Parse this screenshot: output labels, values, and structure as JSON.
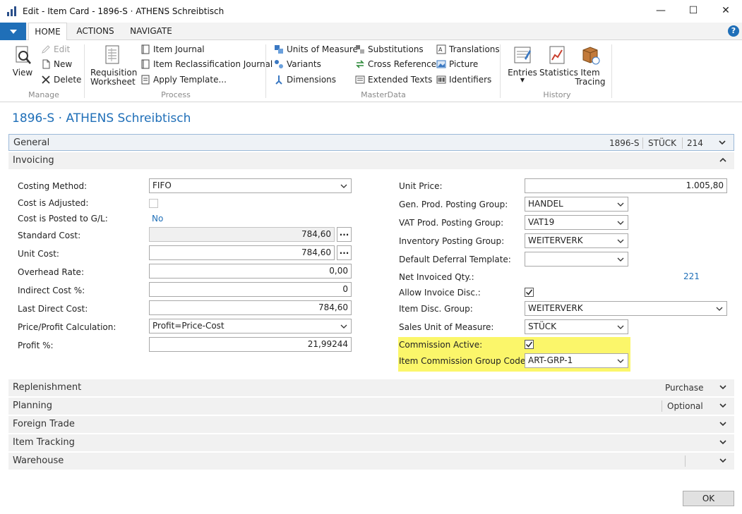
{
  "window": {
    "title": "Edit - Item Card - 1896-S · ATHENS Schreibtisch",
    "minimize": "—",
    "maximize": "☐",
    "close": "✕"
  },
  "ribbon_tabs": [
    {
      "label": "HOME",
      "active": true
    },
    {
      "label": "ACTIONS",
      "active": false
    },
    {
      "label": "NAVIGATE",
      "active": false
    }
  ],
  "help_label": "?",
  "ribbon": {
    "manage": {
      "label": "Manage",
      "view": "View",
      "edit": "Edit",
      "new": "New",
      "delete": "Delete"
    },
    "process": {
      "label": "Process",
      "requisition_worksheet": "Requisition Worksheet",
      "item_journal": "Item Journal",
      "item_reclassification_journal": "Item Reclassification Journal",
      "apply_template": "Apply Template..."
    },
    "masterdata": {
      "label": "MasterData",
      "units_of_measure": "Units of Measure",
      "variants": "Variants",
      "dimensions": "Dimensions",
      "substitutions": "Substitutions",
      "cross_references": "Cross References",
      "extended_texts": "Extended Texts",
      "translations": "Translations",
      "picture": "Picture",
      "identifiers": "Identifiers"
    },
    "history": {
      "label": "History",
      "entries": "Entries",
      "statistics": "Statistics",
      "item_tracing": "Item Tracing"
    }
  },
  "card_title": "1896-S · ATHENS Schreibtisch",
  "fasttabs": {
    "general": {
      "title": "General",
      "summary": [
        "1896-S",
        "STÜCK",
        "214"
      ]
    },
    "invoicing": {
      "title": "Invoicing"
    },
    "replenishment": {
      "title": "Replenishment",
      "summary": "Purchase"
    },
    "planning": {
      "title": "Planning",
      "summary": "Optional"
    },
    "foreign_trade": {
      "title": "Foreign Trade"
    },
    "item_tracking": {
      "title": "Item Tracking"
    },
    "warehouse": {
      "title": "Warehouse"
    }
  },
  "invoicing": {
    "left": {
      "costing_method": {
        "label": "Costing Method:",
        "value": "FIFO"
      },
      "cost_is_adjusted": {
        "label": "Cost is Adjusted:",
        "checked": false
      },
      "cost_posted_gl": {
        "label": "Cost is Posted to G/L:",
        "value": "No"
      },
      "standard_cost": {
        "label": "Standard Cost:",
        "value": "784,60"
      },
      "unit_cost": {
        "label": "Unit Cost:",
        "value": "784,60"
      },
      "overhead_rate": {
        "label": "Overhead Rate:",
        "value": "0,00"
      },
      "indirect_cost": {
        "label": "Indirect Cost %:",
        "value": "0"
      },
      "last_direct_cost": {
        "label": "Last Direct Cost:",
        "value": "784,60"
      },
      "price_profit_calc": {
        "label": "Price/Profit Calculation:",
        "value": "Profit=Price-Cost"
      },
      "profit_pct": {
        "label": "Profit %:",
        "value": "21,99244"
      }
    },
    "right": {
      "unit_price": {
        "label": "Unit Price:",
        "value": "1.005,80"
      },
      "gen_prod_posting_group": {
        "label": "Gen. Prod. Posting Group:",
        "value": "HANDEL"
      },
      "vat_prod_posting_group": {
        "label": "VAT Prod. Posting Group:",
        "value": "VAT19"
      },
      "inventory_posting_group": {
        "label": "Inventory Posting Group:",
        "value": "WEITERVERK"
      },
      "default_deferral_template": {
        "label": "Default Deferral Template:",
        "value": ""
      },
      "net_invoiced_qty": {
        "label": "Net Invoiced Qty.:",
        "value": "221"
      },
      "allow_invoice_disc": {
        "label": "Allow Invoice Disc.:",
        "checked": true
      },
      "item_disc_group": {
        "label": "Item Disc. Group:",
        "value": "WEITERVERK"
      },
      "sales_unit_of_measure": {
        "label": "Sales Unit of Measure:",
        "value": "STÜCK"
      },
      "commission_active": {
        "label": "Commission Active:",
        "checked": true
      },
      "item_commission_group_code": {
        "label": "Item Commission Group Code:",
        "value": "ART-GRP-1"
      }
    },
    "ellipsis": "..."
  },
  "ok_label": "OK",
  "colors": {
    "accent": "#1f6fb8",
    "highlight": "#fbf66a"
  }
}
